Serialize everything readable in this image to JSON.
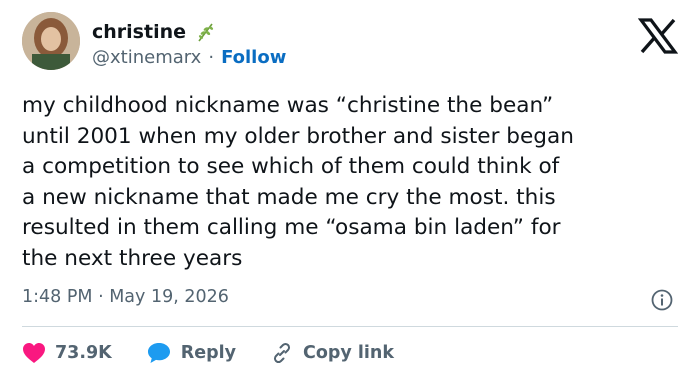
{
  "author": {
    "display_name": "christine",
    "handle": "@xtinemarx",
    "separator": "·",
    "follow_label": "Follow"
  },
  "tweet": {
    "text": "my childhood nickname was “christine the bean”\nuntil 2001 when my older brother and sister began\na competition to see which of them could think of\na new nickname that made me cry the most. this\nresulted in them calling me “osama bin laden” for\nthe next three years",
    "timestamp": "1:48 PM · May 19, 2026"
  },
  "actions": {
    "likes": "73.9K",
    "reply_label": "Reply",
    "copy_link_label": "Copy link"
  },
  "colors": {
    "like": "#f91880",
    "reply": "#1d9bf0",
    "follow": "#0a6dc2",
    "secondary_text": "#536471"
  },
  "icons": [
    "x-logo-icon",
    "sprig-icon",
    "info-icon",
    "heart-icon",
    "reply-bubble-icon",
    "link-icon"
  ]
}
